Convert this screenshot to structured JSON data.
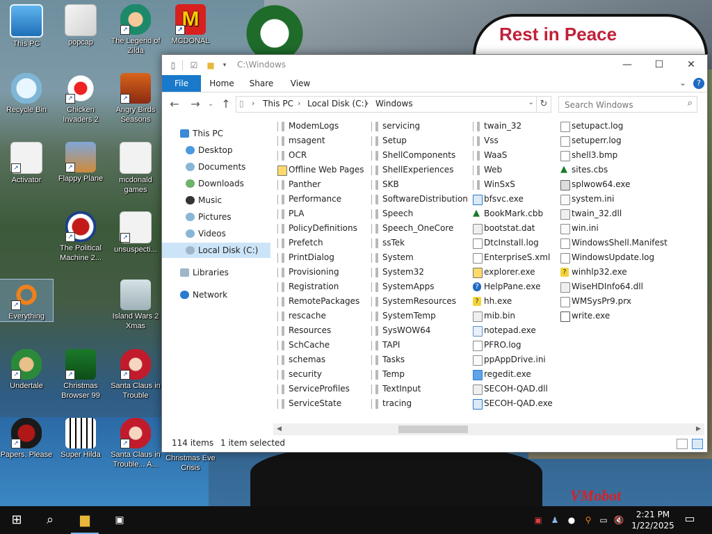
{
  "wallpaper": {
    "rip_sign_text": "Rest in Peace",
    "watermark": "VMobot"
  },
  "desktop_icons": [
    {
      "label": "This PC"
    },
    {
      "label": "popcap"
    },
    {
      "label": "The Legend of Zilda"
    },
    {
      "label": "MCDONAL"
    },
    {
      "label": "Recycle Bin"
    },
    {
      "label": "Chicken Invaders 2"
    },
    {
      "label": "Angry Birds Seasons"
    },
    {
      "label": "Activator"
    },
    {
      "label": "Flappy Plane"
    },
    {
      "label": "mcdonald games"
    },
    {
      "label": "The Political Machine 2..."
    },
    {
      "label": "unsuspecti..."
    },
    {
      "label": "Everything"
    },
    {
      "label": "Island Wars 2 Xmas"
    },
    {
      "label": "Undertale"
    },
    {
      "label": "Christmas Browser 99"
    },
    {
      "label": "Santa Claus in Trouble"
    },
    {
      "label": "Papers, Please"
    },
    {
      "label": "Super Hilda"
    },
    {
      "label": "Santa Claus in Trouble... A..."
    },
    {
      "label": "Christmas Eve Crisis"
    }
  ],
  "explorer": {
    "title": "C:\\Windows",
    "ribbon_tabs": [
      "File",
      "Home",
      "Share",
      "View"
    ],
    "breadcrumb": [
      "This PC",
      "Local Disk (C:)",
      "Windows"
    ],
    "search_placeholder": "Search Windows",
    "nav": [
      {
        "label": "This PC"
      },
      {
        "label": "Desktop"
      },
      {
        "label": "Documents"
      },
      {
        "label": "Downloads"
      },
      {
        "label": "Music"
      },
      {
        "label": "Pictures"
      },
      {
        "label": "Videos"
      },
      {
        "label": "Local Disk (C:)"
      },
      {
        "label": "Libraries"
      },
      {
        "label": "Network"
      }
    ],
    "columns": [
      [
        {
          "name": "ModemLogs",
          "type": "folder"
        },
        {
          "name": "msagent",
          "type": "folder"
        },
        {
          "name": "OCR",
          "type": "folder"
        },
        {
          "name": "Offline Web Pages",
          "type": "web"
        },
        {
          "name": "Panther",
          "type": "folder"
        },
        {
          "name": "Performance",
          "type": "folder"
        },
        {
          "name": "PLA",
          "type": "folder"
        },
        {
          "name": "PolicyDefinitions",
          "type": "folder"
        },
        {
          "name": "Prefetch",
          "type": "folder"
        },
        {
          "name": "PrintDialog",
          "type": "folder"
        },
        {
          "name": "Provisioning",
          "type": "folder"
        },
        {
          "name": "Registration",
          "type": "folder"
        },
        {
          "name": "RemotePackages",
          "type": "folder"
        },
        {
          "name": "rescache",
          "type": "folder"
        },
        {
          "name": "Resources",
          "type": "folder"
        },
        {
          "name": "SchCache",
          "type": "folder"
        },
        {
          "name": "schemas",
          "type": "folder"
        },
        {
          "name": "security",
          "type": "folder"
        },
        {
          "name": "ServiceProfiles",
          "type": "folder"
        },
        {
          "name": "ServiceState",
          "type": "folder"
        }
      ],
      [
        {
          "name": "servicing",
          "type": "folder"
        },
        {
          "name": "Setup",
          "type": "folder"
        },
        {
          "name": "ShellComponents",
          "type": "folder"
        },
        {
          "name": "ShellExperiences",
          "type": "folder"
        },
        {
          "name": "SKB",
          "type": "folder"
        },
        {
          "name": "SoftwareDistribution",
          "type": "folder"
        },
        {
          "name": "Speech",
          "type": "folder"
        },
        {
          "name": "Speech_OneCore",
          "type": "folder"
        },
        {
          "name": "ssTek",
          "type": "folder"
        },
        {
          "name": "System",
          "type": "folder"
        },
        {
          "name": "System32",
          "type": "folder"
        },
        {
          "name": "SystemApps",
          "type": "folder"
        },
        {
          "name": "SystemResources",
          "type": "folder"
        },
        {
          "name": "SystemTemp",
          "type": "folder"
        },
        {
          "name": "SysWOW64",
          "type": "folder"
        },
        {
          "name": "TAPI",
          "type": "folder"
        },
        {
          "name": "Tasks",
          "type": "folder"
        },
        {
          "name": "Temp",
          "type": "folder"
        },
        {
          "name": "TextInput",
          "type": "folder"
        },
        {
          "name": "tracing",
          "type": "folder"
        }
      ],
      [
        {
          "name": "twain_32",
          "type": "folder"
        },
        {
          "name": "Vss",
          "type": "folder"
        },
        {
          "name": "WaaS",
          "type": "folder"
        },
        {
          "name": "Web",
          "type": "folder"
        },
        {
          "name": "WinSxS",
          "type": "folder"
        },
        {
          "name": "bfsvc.exe",
          "type": "exe"
        },
        {
          "name": "BookMark.cbb",
          "type": "tree"
        },
        {
          "name": "bootstat.dat",
          "type": "dll"
        },
        {
          "name": "DtcInstall.log",
          "type": "log"
        },
        {
          "name": "EnterpriseS.xml",
          "type": "log"
        },
        {
          "name": "explorer.exe",
          "type": "web"
        },
        {
          "name": "HelpPane.exe",
          "type": "help"
        },
        {
          "name": "hh.exe",
          "type": "q"
        },
        {
          "name": "mib.bin",
          "type": "dll"
        },
        {
          "name": "notepad.exe",
          "type": "note"
        },
        {
          "name": "PFRO.log",
          "type": "log"
        },
        {
          "name": "ppAppDrive.ini",
          "type": "ini"
        },
        {
          "name": "regedit.exe",
          "type": "reg"
        },
        {
          "name": "SECOH-QAD.dll",
          "type": "dll"
        },
        {
          "name": "SECOH-QAD.exe",
          "type": "exe"
        }
      ],
      [
        {
          "name": "setupact.log",
          "type": "log"
        },
        {
          "name": "setuperr.log",
          "type": "log"
        },
        {
          "name": "shell3.bmp",
          "type": "log"
        },
        {
          "name": "sites.cbs",
          "type": "tree"
        },
        {
          "name": "splwow64.exe",
          "type": "print"
        },
        {
          "name": "system.ini",
          "type": "ini"
        },
        {
          "name": "twain_32.dll",
          "type": "dll"
        },
        {
          "name": "win.ini",
          "type": "ini"
        },
        {
          "name": "WindowsShell.Manifest",
          "type": "log"
        },
        {
          "name": "WindowsUpdate.log",
          "type": "log"
        },
        {
          "name": "winhlp32.exe",
          "type": "q"
        },
        {
          "name": "WiseHDInfo64.dll",
          "type": "dll"
        },
        {
          "name": "WMSysPr9.prx",
          "type": "log"
        },
        {
          "name": "write.exe",
          "type": "write"
        }
      ]
    ],
    "status": {
      "item_count": "114 items",
      "selected": "1 item selected"
    }
  },
  "taskbar": {
    "time": "2:21 PM",
    "date": "1/22/2025"
  }
}
